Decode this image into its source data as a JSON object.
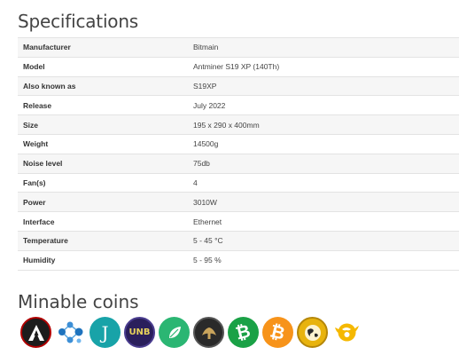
{
  "specs_title": "Specifications",
  "specs": [
    {
      "label": "Manufacturer",
      "value": "Bitmain"
    },
    {
      "label": "Model",
      "value": "Antminer S19 XP (140Th)"
    },
    {
      "label": "Also known as",
      "value": "S19XP"
    },
    {
      "label": "Release",
      "value": "July 2022"
    },
    {
      "label": "Size",
      "value": "195 x 290 x 400mm"
    },
    {
      "label": "Weight",
      "value": "14500g"
    },
    {
      "label": "Noise level",
      "value": "75db"
    },
    {
      "label": "Fan(s)",
      "value": "4"
    },
    {
      "label": "Power",
      "value": "3010W"
    },
    {
      "label": "Interface",
      "value": "Ethernet"
    },
    {
      "label": "Temperature",
      "value": "5 - 45 °C"
    },
    {
      "label": "Humidity",
      "value": "5 - 95 %"
    }
  ],
  "coins_title": "Minable coins",
  "coins": [
    {
      "icon": "acoin-icon",
      "glyph": "A",
      "color": "#1c1c1c"
    },
    {
      "icon": "nodes-coin-icon",
      "glyph": "",
      "color": "#ffffff"
    },
    {
      "icon": "j-coin-icon",
      "glyph": "J",
      "color": "#18a3a8"
    },
    {
      "icon": "unb-coin-icon",
      "glyph": "UNB",
      "color": "#2a1f5c"
    },
    {
      "icon": "leaf-coin-icon",
      "glyph": "",
      "color": "#2bb673"
    },
    {
      "icon": "emblem-coin-icon",
      "glyph": "",
      "color": "#2a2a2a"
    },
    {
      "icon": "bitcoin-cash-icon",
      "glyph": "₿",
      "color": "#1aa146"
    },
    {
      "icon": "bitcoin-icon",
      "glyph": "₿",
      "color": "#f7931a"
    },
    {
      "icon": "globe-coin-icon",
      "glyph": "",
      "color": "#e8b30d"
    },
    {
      "icon": "bird-coin-icon",
      "glyph": "",
      "color": "#f5b800"
    }
  ]
}
